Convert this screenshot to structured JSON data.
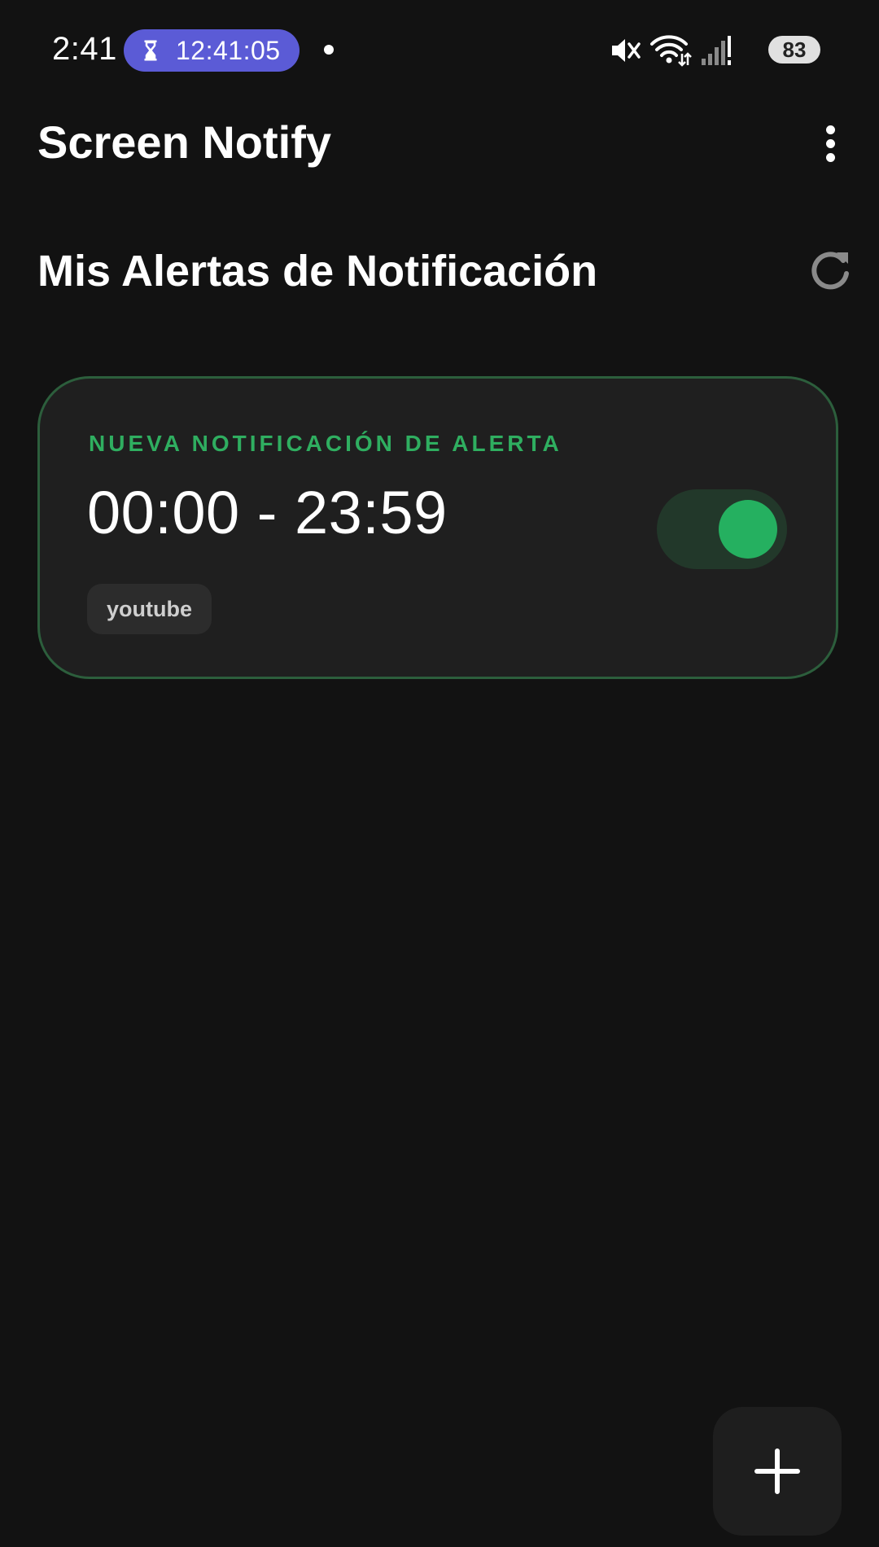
{
  "status_bar": {
    "time": "2:41",
    "timer": "12:41:05",
    "battery": "83",
    "icons": [
      "hourglass-icon",
      "mute-icon",
      "wifi-icon",
      "signal-icon",
      "battery-icon"
    ]
  },
  "app_bar": {
    "title": "Screen Notify",
    "more_icon": "more-vert-icon"
  },
  "section": {
    "title": "Mis Alertas de Notificación",
    "refresh_icon": "refresh-icon"
  },
  "alerts": [
    {
      "label": "NUEVA NOTIFICACIÓN DE ALERTA",
      "time_range": "00:00 - 23:59",
      "tag": "youtube",
      "enabled": true
    }
  ],
  "fab": {
    "icon": "plus-icon"
  },
  "colors": {
    "background": "#121212",
    "card": "#1f1f1f",
    "card_border": "#2c5e3c",
    "accent_green": "#2fae60",
    "toggle_track": "#22382a",
    "toggle_knob": "#25b060",
    "timer_pill": "#5b5bd6",
    "tag_bg": "#2c2c2c"
  }
}
